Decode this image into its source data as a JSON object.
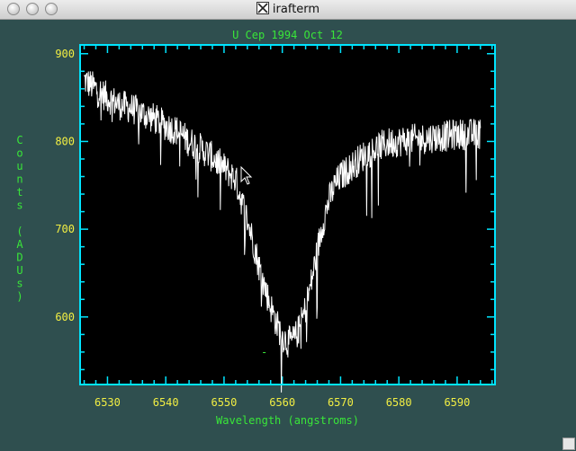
{
  "window": {
    "title": "irafterm",
    "icon": "x11-icon"
  },
  "colors": {
    "background": "#2f4f4f",
    "plot_bg": "#000000",
    "frame": "#00e5ff",
    "data_line": "#ffffff",
    "label_green": "#39e639",
    "tick_yellow": "#f2ee43"
  },
  "chart_data": {
    "type": "line",
    "title": "U Cep 1994 Oct 12",
    "xlabel": "Wavelength (angstroms)",
    "ylabel": "Counts (ADUs)",
    "xlim": [
      6525.3,
      6596.5
    ],
    "ylim": [
      523,
      910
    ],
    "xticks": [
      6530,
      6540,
      6550,
      6560,
      6570,
      6580,
      6590
    ],
    "yticks": [
      600,
      700,
      800,
      900
    ],
    "grid": false,
    "legend": "none",
    "annotation": "-",
    "series": [
      {
        "x": [
          6526,
          6528,
          6530,
          6532,
          6534,
          6536,
          6538,
          6540,
          6542,
          6544,
          6546,
          6548,
          6550,
          6552,
          6553,
          6554,
          6555,
          6556,
          6557,
          6558,
          6559,
          6560,
          6561,
          6562,
          6563,
          6564,
          6565,
          6566,
          6567,
          6568,
          6569,
          6570,
          6572,
          6574,
          6576,
          6578,
          6580,
          6582,
          6584,
          6586,
          6588,
          6590,
          6592,
          6594
        ],
        "y": [
          870,
          860,
          850,
          842,
          838,
          832,
          826,
          818,
          812,
          800,
          792,
          782,
          770,
          757,
          733,
          711,
          686,
          658,
          634,
          612,
          593,
          578,
          571,
          574,
          588,
          610,
          640,
          676,
          708,
          733,
          750,
          760,
          772,
          784,
          792,
          798,
          800,
          802,
          803,
          805,
          806,
          808,
          808,
          809
        ]
      }
    ]
  }
}
